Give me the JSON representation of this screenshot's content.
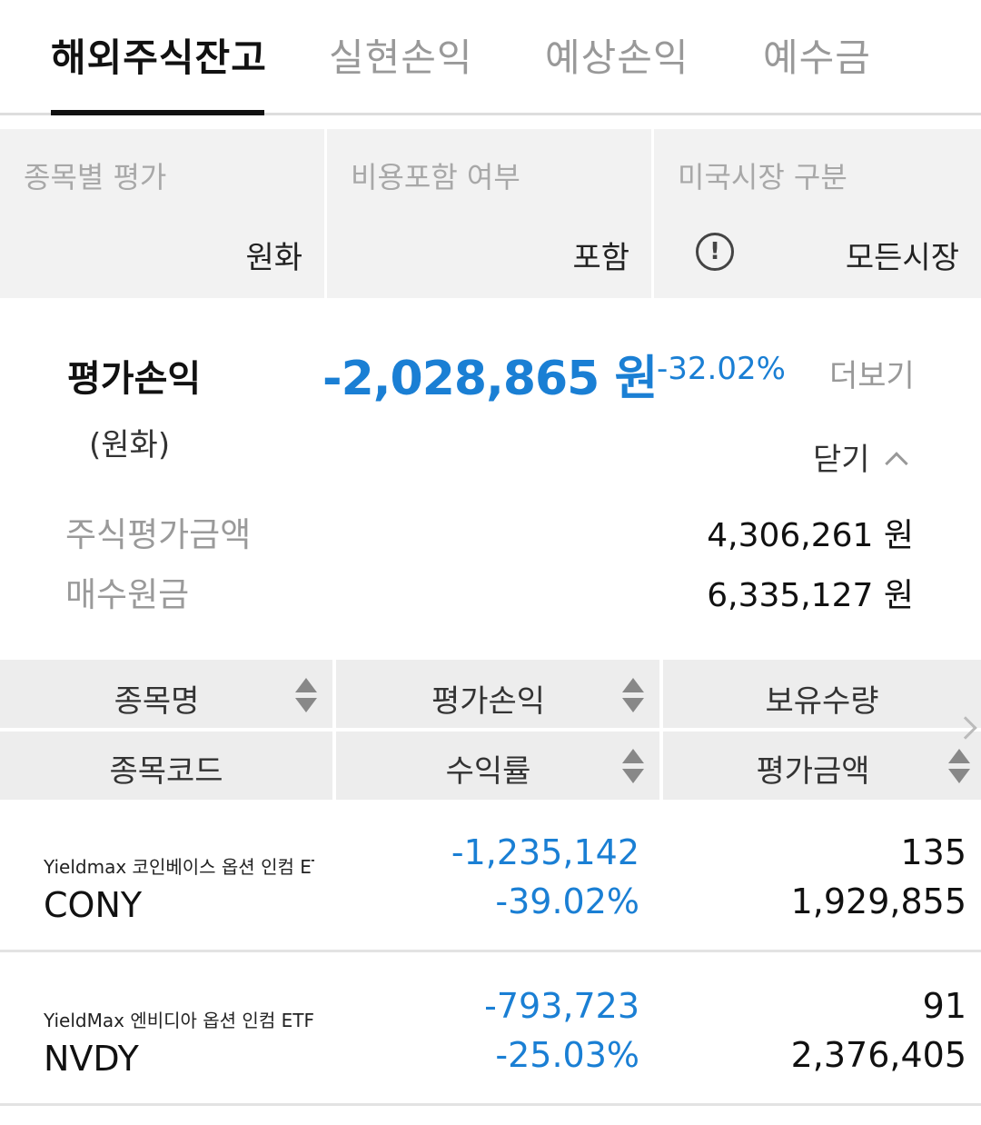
{
  "tabs": [
    {
      "label": "해외주식잔고",
      "active": true
    },
    {
      "label": "실현손익",
      "active": false
    },
    {
      "label": "예상손익",
      "active": false
    },
    {
      "label": "예수금",
      "active": false
    }
  ],
  "filters": {
    "valuation": {
      "label": "종목별 평가",
      "value": "원화"
    },
    "fees": {
      "label": "비용포함 여부",
      "value": "포함"
    },
    "market": {
      "label": "미국시장 구분",
      "info_icon": "!",
      "value": "모든시장"
    }
  },
  "summary": {
    "label": "평가손익",
    "sub_label": "(원화)",
    "amount": "-2,028,865 원",
    "rate": "-32.02%",
    "more_label": "더보기",
    "close_label": "닫기",
    "details": [
      {
        "label": "주식평가금액",
        "value": "4,306,261 원"
      },
      {
        "label": "매수원금",
        "value": "6,335,127 원"
      }
    ]
  },
  "table": {
    "headers_top": [
      "종목명",
      "평가손익",
      "보유수량"
    ],
    "headers_bottom": [
      "종목코드",
      "수익률",
      "평가금액"
    ],
    "rows": [
      {
        "name": "Yieldmax 코인베이스 옵션 인컴 ETF",
        "code": "CONY",
        "pl": "-1,235,142",
        "rate": "-39.02%",
        "qty": "135",
        "value": "1,929,855"
      },
      {
        "name": "YieldMax 엔비디아 옵션 인컴 ETF",
        "code": "NVDY",
        "pl": "-793,723",
        "rate": "-25.03%",
        "qty": "91",
        "value": "2,376,405"
      }
    ]
  },
  "colors": {
    "accent_blue": "#1a7fd4",
    "header_bg": "#ededed",
    "filter_bg": "#f2f2f2"
  }
}
